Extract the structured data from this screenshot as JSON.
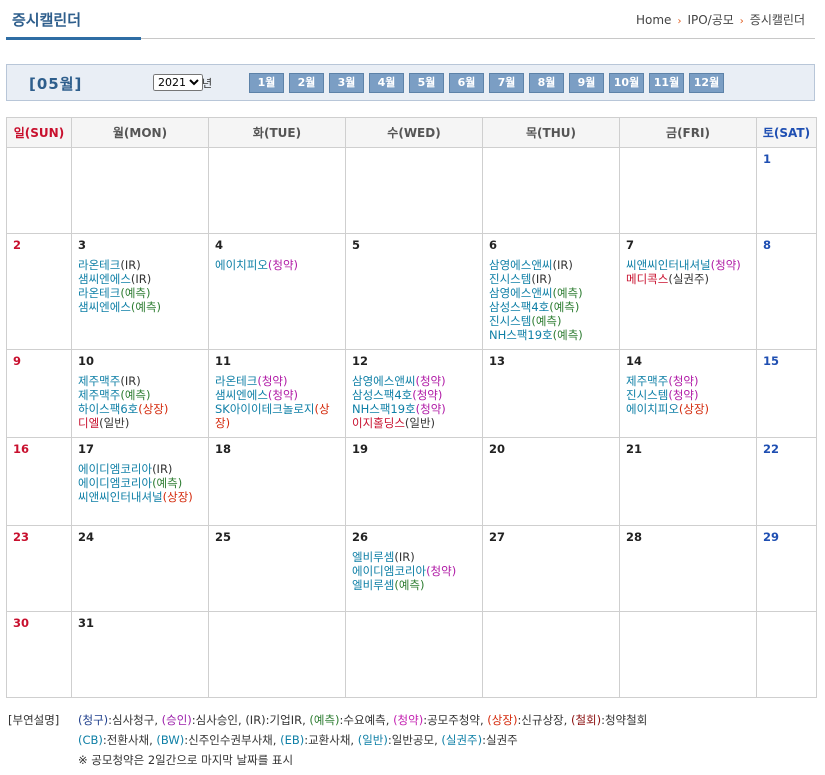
{
  "header": {
    "title": "증시캘린더",
    "breadcrumb": [
      "Home",
      "IPO/공모",
      "증시캘린더"
    ]
  },
  "selector": {
    "current_month": "[05월]",
    "year": "2021",
    "year_suffix": "년",
    "months": [
      "1월",
      "2월",
      "3월",
      "4월",
      "5월",
      "6월",
      "7월",
      "8월",
      "9월",
      "10월",
      "11월",
      "12월"
    ]
  },
  "weekdays": [
    "일(SUN)",
    "월(MON)",
    "화(TUE)",
    "수(WED)",
    "목(THU)",
    "금(FRI)",
    "토(SAT)"
  ],
  "weeks": [
    [
      {
        "day": ""
      },
      {
        "day": ""
      },
      {
        "day": ""
      },
      {
        "day": ""
      },
      {
        "day": ""
      },
      {
        "day": ""
      },
      {
        "day": "1",
        "events": []
      }
    ],
    [
      {
        "day": "2",
        "events": []
      },
      {
        "day": "3",
        "events": [
          {
            "name": "라온테크",
            "tag": "(IR)",
            "type": "ir"
          },
          {
            "name": "샘씨엔에스",
            "tag": "(IR)",
            "type": "ir"
          },
          {
            "name": "라온테크",
            "tag": "(예측)",
            "type": "forecast"
          },
          {
            "name": "샘씨엔에스",
            "tag": "(예측)",
            "type": "forecast"
          }
        ]
      },
      {
        "day": "4",
        "events": [
          {
            "name": "에이치피오",
            "tag": "(청약)",
            "type": "sub"
          }
        ]
      },
      {
        "day": "5",
        "events": []
      },
      {
        "day": "6",
        "events": [
          {
            "name": "삼영에스앤씨",
            "tag": "(IR)",
            "type": "ir"
          },
          {
            "name": "진시스템",
            "tag": "(IR)",
            "type": "ir"
          },
          {
            "name": "삼영에스앤씨",
            "tag": "(예측)",
            "type": "forecast"
          },
          {
            "name": "삼성스팩4호",
            "tag": "(예측)",
            "type": "forecast"
          },
          {
            "name": "진시스템",
            "tag": "(예측)",
            "type": "forecast"
          },
          {
            "name": "NH스팩19호",
            "tag": "(예측)",
            "type": "forecast"
          }
        ]
      },
      {
        "day": "7",
        "events": [
          {
            "name": "씨앤씨인터내셔널",
            "tag": "(청약)",
            "type": "sub"
          },
          {
            "name": "메디콕스",
            "tag": "(실권주)",
            "type": "rights",
            "red": true
          }
        ]
      },
      {
        "day": "8",
        "events": []
      }
    ],
    [
      {
        "day": "9",
        "events": []
      },
      {
        "day": "10",
        "events": [
          {
            "name": "제주맥주",
            "tag": "(IR)",
            "type": "ir"
          },
          {
            "name": "제주맥주",
            "tag": "(예측)",
            "type": "forecast"
          },
          {
            "name": "하이스팩6호",
            "tag": "(상장)",
            "type": "list"
          },
          {
            "name": "디엘",
            "tag": "(일반)",
            "type": "ipo",
            "red": true
          }
        ]
      },
      {
        "day": "11",
        "events": [
          {
            "name": "라온테크",
            "tag": "(청약)",
            "type": "sub"
          },
          {
            "name": "샘씨엔에스",
            "tag": "(청약)",
            "type": "sub"
          },
          {
            "name": "SK아이이테크놀로지",
            "tag": "(상장)",
            "type": "list"
          }
        ]
      },
      {
        "day": "12",
        "events": [
          {
            "name": "삼영에스앤씨",
            "tag": "(청약)",
            "type": "sub"
          },
          {
            "name": "삼성스팩4호",
            "tag": "(청약)",
            "type": "sub"
          },
          {
            "name": "NH스팩19호",
            "tag": "(청약)",
            "type": "sub"
          },
          {
            "name": "이지홀딩스",
            "tag": "(일반)",
            "type": "ipo",
            "red": true
          }
        ]
      },
      {
        "day": "13",
        "events": []
      },
      {
        "day": "14",
        "events": [
          {
            "name": "제주맥주",
            "tag": "(청약)",
            "type": "sub"
          },
          {
            "name": "진시스템",
            "tag": "(청약)",
            "type": "sub"
          },
          {
            "name": "에이치피오",
            "tag": "(상장)",
            "type": "list"
          }
        ]
      },
      {
        "day": "15",
        "events": []
      }
    ],
    [
      {
        "day": "16",
        "events": []
      },
      {
        "day": "17",
        "events": [
          {
            "name": "에이디엠코리아",
            "tag": "(IR)",
            "type": "ir"
          },
          {
            "name": "에이디엠코리아",
            "tag": "(예측)",
            "type": "forecast"
          },
          {
            "name": "씨앤씨인터내셔널",
            "tag": "(상장)",
            "type": "list"
          }
        ]
      },
      {
        "day": "18",
        "events": []
      },
      {
        "day": "19",
        "events": []
      },
      {
        "day": "20",
        "events": []
      },
      {
        "day": "21",
        "events": []
      },
      {
        "day": "22",
        "events": []
      }
    ],
    [
      {
        "day": "23",
        "events": []
      },
      {
        "day": "24",
        "events": []
      },
      {
        "day": "25",
        "events": []
      },
      {
        "day": "26",
        "events": [
          {
            "name": "엘비루셈",
            "tag": "(IR)",
            "type": "ir"
          },
          {
            "name": "에이디엠코리아",
            "tag": "(청약)",
            "type": "sub"
          },
          {
            "name": "엘비루셈",
            "tag": "(예측)",
            "type": "forecast"
          }
        ]
      },
      {
        "day": "27",
        "events": []
      },
      {
        "day": "28",
        "events": []
      },
      {
        "day": "29",
        "events": []
      }
    ],
    [
      {
        "day": "30",
        "events": []
      },
      {
        "day": "31",
        "events": []
      },
      {
        "day": ""
      },
      {
        "day": ""
      },
      {
        "day": ""
      },
      {
        "day": ""
      },
      {
        "day": ""
      }
    ]
  ],
  "legend": {
    "label": "[부연설명]",
    "line1": [
      {
        "k": "(청구)",
        "v": ":심사청구, ",
        "c": "c-navy"
      },
      {
        "k": "(승인)",
        "v": ":심사승인, ",
        "c": "c-purple"
      },
      {
        "k": "(IR)",
        "v": ":기업IR, ",
        "c": ""
      },
      {
        "k": "(예측)",
        "v": ":수요예측, ",
        "c": "c-green"
      },
      {
        "k": "(청약)",
        "v": ":공모주청약, ",
        "c": "c-pink"
      },
      {
        "k": "(상장)",
        "v": ":신규상장, ",
        "c": "c-red"
      },
      {
        "k": "(철회)",
        "v": ":청약철회",
        "c": "c-darkred"
      }
    ],
    "line2": [
      {
        "k": "(CB)",
        "v": ":전환사채, ",
        "c": "c-blue"
      },
      {
        "k": "(BW)",
        "v": ":신주인수권부사채, ",
        "c": "c-blue"
      },
      {
        "k": "(EB)",
        "v": ":교환사채, ",
        "c": "c-blue"
      },
      {
        "k": "(일반)",
        "v": ":일반공모, ",
        "c": "c-blue"
      },
      {
        "k": "(실권주)",
        "v": ":실권주",
        "c": "c-blue"
      }
    ],
    "note": "※ 공모청약은 2일간으로 마지막 날짜를 표시"
  }
}
